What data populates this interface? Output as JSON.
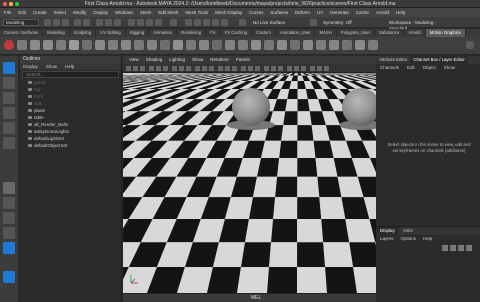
{
  "window": {
    "title": "First Class Arnold.ma - Autodesk MAYA 2024.2: /Users/lorielbeeb/Documents/maya/projects/lorie_W26practice/scenes/First Class Arnold.ma"
  },
  "menubar": {
    "items": [
      "File",
      "Edit",
      "Create",
      "Select",
      "Modify",
      "Display",
      "Windows",
      "Mesh",
      "Edit Mesh",
      "Mesh Tools",
      "Mesh Display",
      "Curves",
      "Surfaces",
      "Deform",
      "UV",
      "Generate",
      "Cache",
      "Arnold",
      "Help"
    ]
  },
  "statusline": {
    "workspace": "Modeling",
    "live_surface": "No Live Surface",
    "symmetry": "Symmetry: Off",
    "workspace_right": "Workspace : Modeling - Standard"
  },
  "shelf_tabs": [
    "Curves / Surfaces",
    "Modeling",
    "Sculpting",
    "UV Editing",
    "Rigging",
    "Animation",
    "Rendering",
    "FX",
    "FX Caching",
    "Custom",
    "Animation_User",
    "MASH",
    "Polygons_User",
    "Substance",
    "Arnold",
    "Motion Graphics"
  ],
  "outliner": {
    "title": "Outliner",
    "menu": [
      "Display",
      "Show",
      "Help"
    ],
    "search_placeholder": "Search...",
    "rows": [
      {
        "label": "persp",
        "dim": true
      },
      {
        "label": "top",
        "dim": true
      },
      {
        "label": "front",
        "dim": true
      },
      {
        "label": "side",
        "dim": true
      },
      {
        "label": "plane",
        "dim": false
      },
      {
        "label": "table",
        "dim": false
      },
      {
        "label": "all_Render_Balls",
        "dim": false
      },
      {
        "label": "aiSkyDomeLight1",
        "dim": false
      },
      {
        "label": "defaultLightSet",
        "dim": false
      },
      {
        "label": "defaultObjectSet",
        "dim": false
      }
    ]
  },
  "viewport": {
    "menu": [
      "View",
      "Shading",
      "Lighting",
      "Show",
      "Renderer",
      "Panels"
    ]
  },
  "channelbox": {
    "tabs": [
      "Attribute Editor",
      "Channel Box / Layer Editor"
    ],
    "menu": [
      "Channels",
      "Edit",
      "Object",
      "Show"
    ],
    "help": "Select objects in the scene to view, edit and set keyframes on channels (attributes)"
  },
  "layers": {
    "tabs": [
      "Display",
      "Anim"
    ],
    "menu": [
      "Layers",
      "Options",
      "Help"
    ]
  },
  "cmdline": {
    "label": "MEL"
  },
  "colors": {
    "accent": "#1f7ad6",
    "checker_dark": "#141414",
    "checker_light": "#d8d8d8"
  }
}
